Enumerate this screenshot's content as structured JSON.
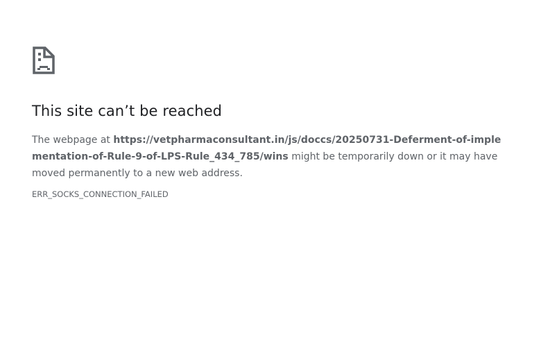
{
  "icon": "sad-document-icon",
  "title": "This site can’t be reached",
  "message": {
    "prefix": "The webpage at ",
    "url": "https://vetpharmaconsultant.in/js/doccs/20250731-Deferment-of-implementation-of-Rule-9-of-LPS-Rule_434_785/wins",
    "suffix": " might be temporarily down or it may have moved permanently to a new web address."
  },
  "error_code": "ERR_SOCKS_CONNECTION_FAILED",
  "colors": {
    "text_primary": "#202124",
    "text_secondary": "#5f6368",
    "icon": "#5f6368"
  }
}
